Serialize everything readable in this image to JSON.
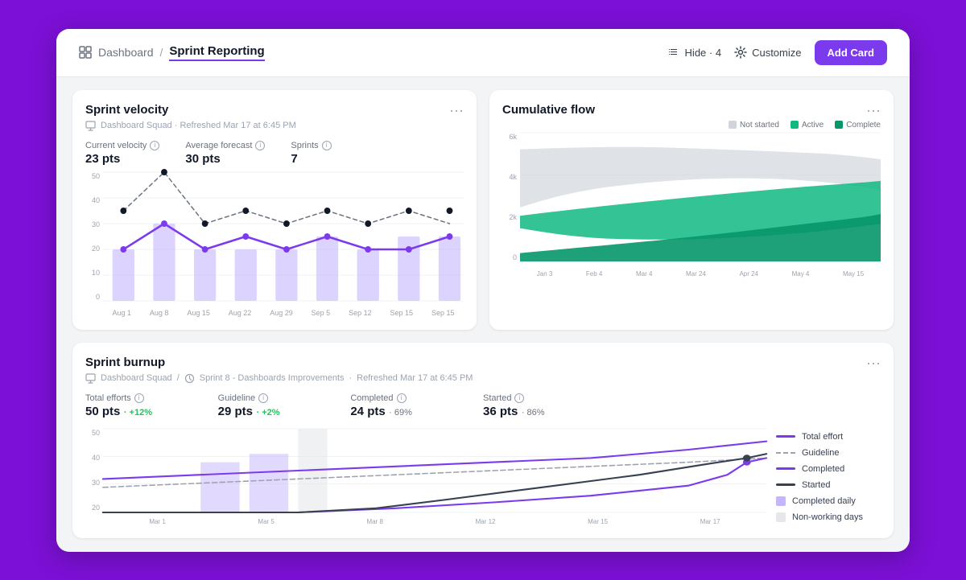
{
  "header": {
    "breadcrumb_parent": "Dashboard",
    "breadcrumb_current": "Sprint Reporting",
    "hide_label": "Hide · 4",
    "customize_label": "Customize",
    "add_card_label": "Add Card"
  },
  "sprint_velocity": {
    "title": "Sprint velocity",
    "meta": "Dashboard Squad · Refreshed Mar 17 at 6:45 PM",
    "current_velocity_label": "Current velocity",
    "current_velocity_value": "23 pts",
    "avg_forecast_label": "Average forecast",
    "avg_forecast_value": "30 pts",
    "sprints_label": "Sprints",
    "sprints_value": "7",
    "x_labels": [
      "Aug 1",
      "Aug 8",
      "Aug 15",
      "Aug 22",
      "Aug 29",
      "Sep 5",
      "Sep 12",
      "Sep 15",
      "Sep 15"
    ]
  },
  "cumulative_flow": {
    "title": "Cumulative flow",
    "legend": [
      {
        "label": "Not started",
        "color": "#d1d5db"
      },
      {
        "label": "Active",
        "color": "#10b981"
      },
      {
        "label": "Complete",
        "color": "#059669"
      }
    ],
    "y_labels": [
      "6k",
      "4k",
      "2k",
      "0"
    ],
    "x_labels": [
      "Jan 3",
      "Feb 4",
      "Mar 4",
      "Mar 24",
      "Apr 24",
      "May 4",
      "May 15"
    ]
  },
  "sprint_burnup": {
    "title": "Sprint burnup",
    "meta_team": "Dashboard Squad",
    "meta_sprint": "Sprint 8 - Dashboards Improvements",
    "meta_refresh": "Refreshed Mar 17 at 6:45 PM",
    "stats": [
      {
        "label": "Total efforts",
        "value": "50 pts",
        "change": "+12%",
        "positive": true
      },
      {
        "label": "Guideline",
        "value": "29 pts",
        "change": "+2%",
        "positive": true
      },
      {
        "label": "Completed",
        "value": "24 pts",
        "change": "69%",
        "positive": null
      },
      {
        "label": "Started",
        "value": "36 pts",
        "change": "86%",
        "positive": null
      }
    ],
    "y_labels": [
      "50",
      "40",
      "30",
      "20"
    ],
    "legend": [
      {
        "label": "Total effort",
        "type": "solid",
        "color": "#7c3aed"
      },
      {
        "label": "Guideline",
        "type": "dashed",
        "color": "#9ca3af"
      },
      {
        "label": "Completed",
        "type": "solid",
        "color": "#7c3aed"
      },
      {
        "label": "Started",
        "type": "solid",
        "color": "#374151"
      },
      {
        "label": "Completed daily",
        "type": "square",
        "color": "#c4b5fd"
      },
      {
        "label": "Non-working days",
        "type": "square",
        "color": "#e5e7eb"
      }
    ]
  }
}
